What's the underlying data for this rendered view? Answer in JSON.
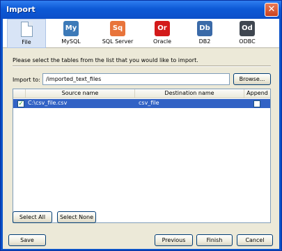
{
  "window": {
    "title": "Import",
    "close_glyph": "✕"
  },
  "toolbar": {
    "items": [
      {
        "label": "File",
        "icon": "file-icon",
        "abbr": "",
        "color": ""
      },
      {
        "label": "MySQL",
        "icon": "mysql-icon",
        "abbr": "My",
        "color": "#3d7ab8"
      },
      {
        "label": "SQL Server",
        "icon": "sqlserver-icon",
        "abbr": "Sq",
        "color": "#e8743b"
      },
      {
        "label": "Oracle",
        "icon": "oracle-icon",
        "abbr": "Or",
        "color": "#d31a1a"
      },
      {
        "label": "DB2",
        "icon": "db2-icon",
        "abbr": "Db",
        "color": "#3a6aa8"
      },
      {
        "label": "ODBC",
        "icon": "odbc-icon",
        "abbr": "Od",
        "color": "#3f4650"
      }
    ],
    "selected": "File"
  },
  "instruction": "Please select the tables from the list that you would like to import.",
  "import_to": {
    "label": "Import to:",
    "value": "/imported_text_files",
    "browse_label": "Browse..."
  },
  "table": {
    "columns": [
      "Source name",
      "Destination name",
      "Append"
    ],
    "rows": [
      {
        "selected": true,
        "source": "C:\\csv_file.csv",
        "destination": "csv_file",
        "append": false
      }
    ],
    "check_glyph": "✓"
  },
  "buttons": {
    "select_all": "Select All",
    "select_none": "Select None",
    "save": "Save",
    "previous": "Previous",
    "finish": "Finish",
    "cancel": "Cancel"
  }
}
